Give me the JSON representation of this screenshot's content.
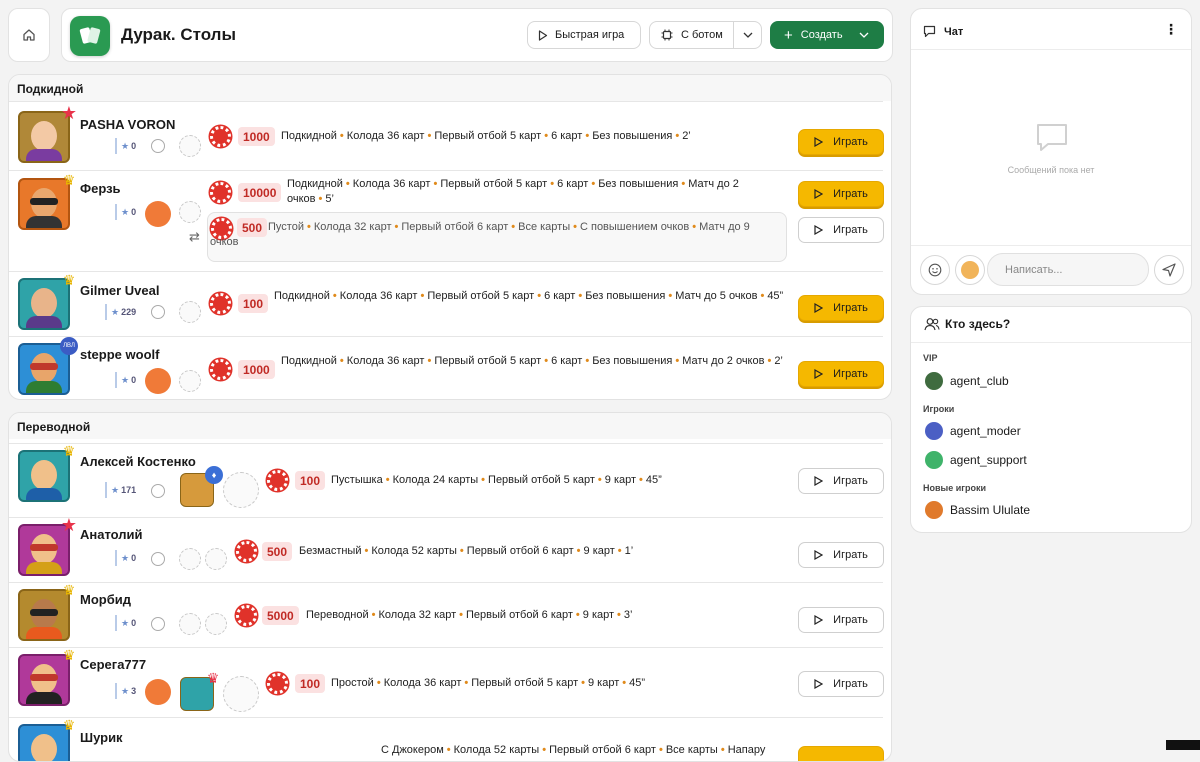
{
  "header": {
    "title": "Дурак. Столы",
    "quick_game": "Быстрая игра",
    "with_bot": "С ботом",
    "create": "Создать"
  },
  "sections": [
    {
      "title": "Подкидной"
    },
    {
      "title": "Переводной"
    }
  ],
  "play_label": "Играть",
  "rows": [
    {
      "name": "PASHA VORON",
      "rating": "0",
      "bet": "1000",
      "mode": "Подкидной",
      "deck": "Колода 36 карт",
      "first": "Первый отбой 5 карт",
      "cards": "6 карт",
      "raise": "Без повышения",
      "time": "2’"
    },
    {
      "name": "Ферзь",
      "rating": "0",
      "bet": "10000",
      "mode": "Подкидной",
      "deck": "Колода 36 карт",
      "first": "Первый отбой 5 карт",
      "cards": "6 карт",
      "raise": "Без повышения",
      "match": "Матч до 2 очков",
      "time": "5’",
      "sub": {
        "bet": "500",
        "mode": "Пустой",
        "deck": "Колода 32 карт",
        "first": "Первый отбой 6 карт",
        "cards": "Все карты",
        "raise": "С повышением очков",
        "match": "Матч до 9 очков"
      }
    },
    {
      "name": "Gilmer Uveal",
      "rating": "229",
      "bet": "100",
      "mode": "Подкидной",
      "deck": "Колода 36 карт",
      "first": "Первый отбой 5 карт",
      "cards": "6 карт",
      "raise": "Без повышения",
      "match": "Матч до 5 очков",
      "time": "45”"
    },
    {
      "name": "steppe woolf",
      "rating": "0",
      "bet": "1000",
      "mode": "Подкидной",
      "deck": "Колода 36 карт",
      "first": "Первый отбой 5 карт",
      "cards": "6 карт",
      "raise": "Без повышения",
      "match": "Матч до 2 очков",
      "time": "2’"
    },
    {
      "name": "Алексей Костенко",
      "rating": "171",
      "bet": "100",
      "mode": "Пустышка",
      "deck": "Колода 24 карты",
      "first": "Первый отбой 5 карт",
      "cards": "9 карт",
      "time": "45”"
    },
    {
      "name": "Анатолий",
      "rating": "0",
      "bet": "500",
      "mode": "Безмастный",
      "deck": "Колода 52 карты",
      "first": "Первый отбой 6 карт",
      "cards": "9 карт",
      "time": "1’"
    },
    {
      "name": "Морбид",
      "rating": "0",
      "bet": "5000",
      "mode": "Переводной",
      "deck": "Колода 32 карт",
      "first": "Первый отбой 6 карт",
      "cards": "9 карт",
      "time": "3’"
    },
    {
      "name": "Серега777",
      "rating": "3",
      "bet": "100",
      "mode": "Простой",
      "deck": "Колода 36 карт",
      "first": "Первый отбой 5 карт",
      "cards": "9 карт",
      "time": "45”"
    },
    {
      "name": "Шурик",
      "mode": "С Джокером",
      "deck": "Колода 52 карты",
      "first": "Первый отбой 6 карт",
      "cards": "Все карты",
      "extra": "Напару"
    }
  ],
  "chat": {
    "title": "Чат",
    "empty": "Сообщений пока нет",
    "placeholder": "Написать..."
  },
  "who": {
    "title": "Кто здесь?",
    "vip_label": "VIP",
    "players_label": "Игроки",
    "new_label": "Новые игроки",
    "vip": [
      "agent_club"
    ],
    "players": [
      "agent_moder",
      "agent_support"
    ],
    "new": [
      "Bassim Ululate"
    ]
  },
  "colors": {
    "accent": "#1e7d45",
    "play": "#f5b800",
    "chip": "#e0322a",
    "separator": "#e08a1b"
  }
}
